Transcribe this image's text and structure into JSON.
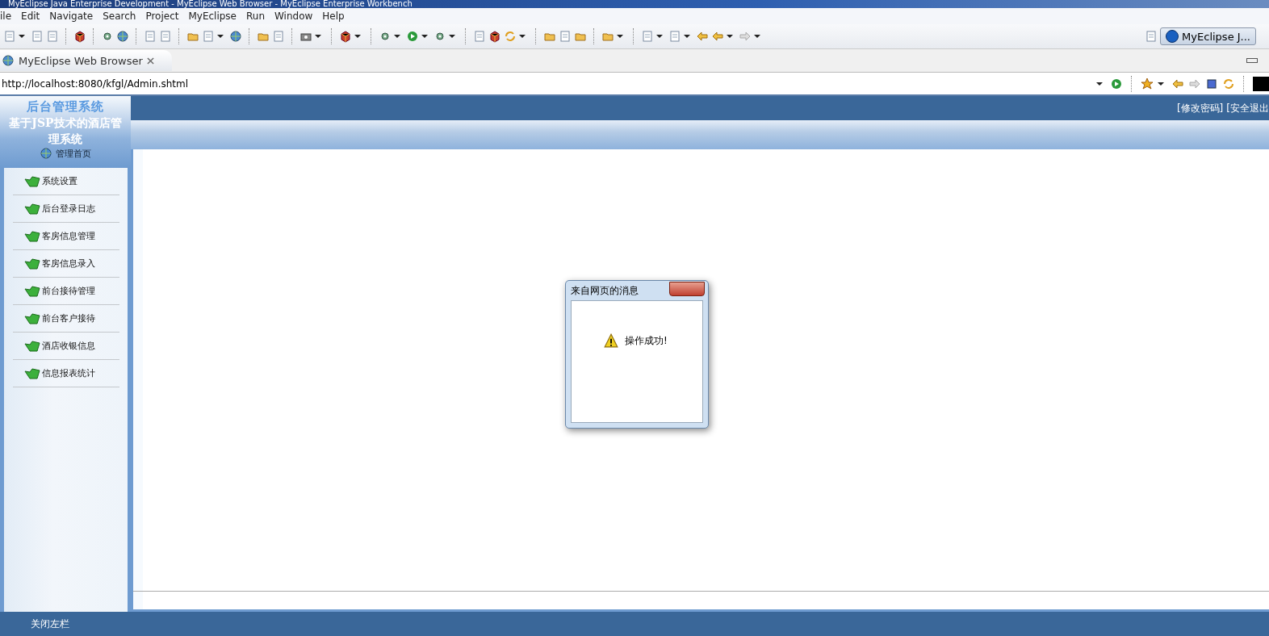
{
  "window": {
    "title": "MyEclipse Java Enterprise Development - MyEclipse Web Browser - MyEclipse Enterprise Workbench"
  },
  "menu": [
    "ile",
    "Edit",
    "Navigate",
    "Search",
    "Project",
    "MyEclipse",
    "Run",
    "Window",
    "Help"
  ],
  "perspective": {
    "label": "MyEclipse J..."
  },
  "editor_tab": {
    "label": "MyEclipse Web Browser"
  },
  "browser": {
    "url": "http://localhost:8080/kfgl/Admin.shtml"
  },
  "page": {
    "logo": "后台管理系统",
    "subtitle": "基于JSP技术的酒店管理系统",
    "home_link": "管理首页",
    "top_links": [
      "[修改密码]",
      "[安全退出"
    ],
    "sidebar": {
      "items": [
        "系统设置",
        "后台登录日志",
        "客房信息管理",
        "客房信息录入",
        "前台接待管理",
        "前台客户接待",
        "酒店收银信息",
        "信息报表统计"
      ]
    },
    "dialog": {
      "title": "来自网页的消息",
      "message": "操作成功!"
    },
    "footer_link": "关闭左栏"
  }
}
